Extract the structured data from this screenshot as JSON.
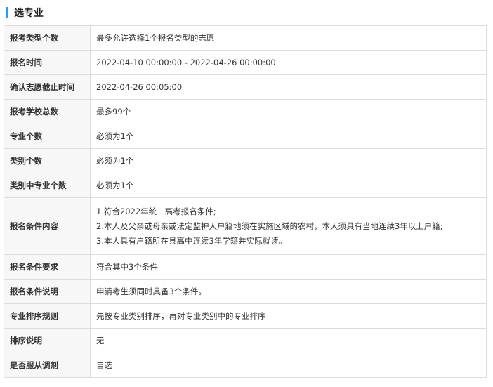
{
  "section": {
    "title": "选专业",
    "accent_color": "#2a9df4"
  },
  "rows": [
    {
      "label": "报考类型个数",
      "value": "最多允许选择1个报名类型的志愿"
    },
    {
      "label": "报名时间",
      "value": "2022-04-10 00:00:00 - 2022-04-26 00:00:00"
    },
    {
      "label": "确认志愿截止时间",
      "value": "2022-04-26 00:05:00"
    },
    {
      "label": "报考学校总数",
      "value": "最多99个"
    },
    {
      "label": "专业个数",
      "value": "必须为1个"
    },
    {
      "label": "类别个数",
      "value": "必须为1个"
    },
    {
      "label": "类别中专业个数",
      "value": "必须为1个"
    },
    {
      "label": "报名条件内容",
      "lines": [
        "1.符合2022年统一高考报名条件;",
        "2.本人及父亲或母亲或法定监护人户籍地须在实施区域的农村，本人须具有当地连续3年以上户籍;",
        "3.本人具有户籍所在县高中连续3年学籍并实际就读。"
      ]
    },
    {
      "label": "报名条件要求",
      "value": "符合其中3个条件"
    },
    {
      "label": "报名条件说明",
      "value": "申请考生须同时具备3个条件。"
    },
    {
      "label": "专业排序规则",
      "value": "先按专业类别排序，再对专业类别中的专业排序"
    },
    {
      "label": "排序说明",
      "value": "无"
    },
    {
      "label": "是否服从调剂",
      "value": "自选"
    }
  ]
}
